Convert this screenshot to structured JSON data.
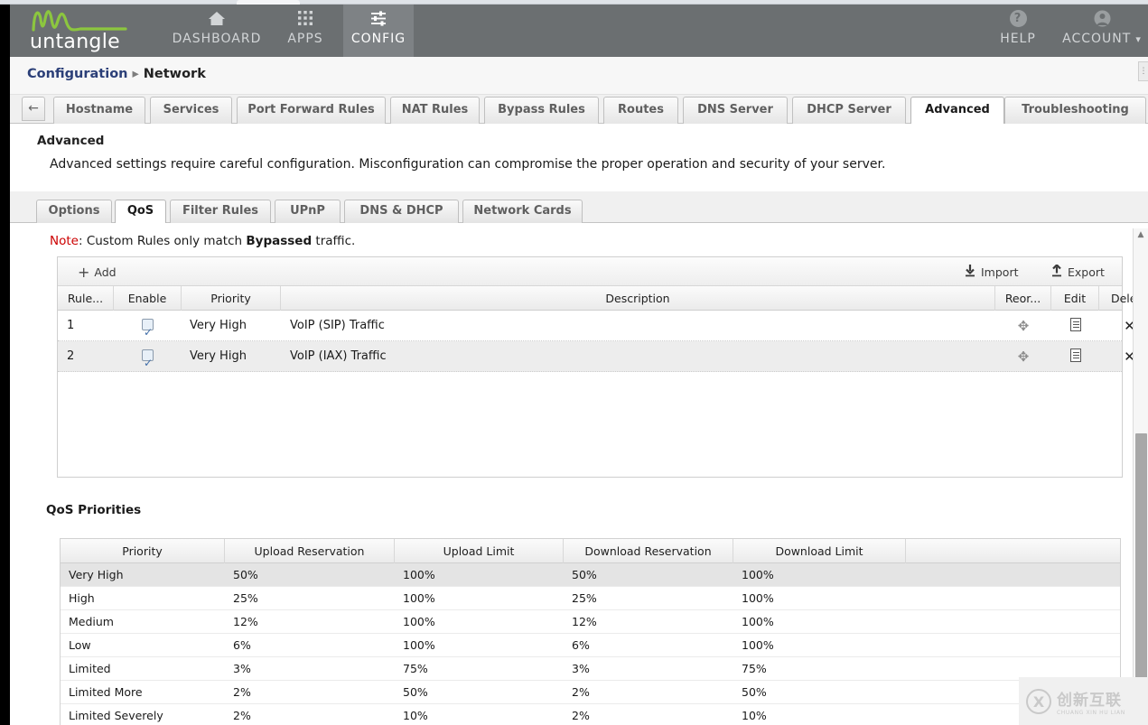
{
  "browser": {
    "tab_stub": ""
  },
  "header": {
    "logo_text": "untangle",
    "nav": [
      {
        "label": "DASHBOARD",
        "icon": "home-icon",
        "active": false
      },
      {
        "label": "APPS",
        "icon": "grid-icon",
        "active": false
      },
      {
        "label": "CONFIG",
        "icon": "sliders-icon",
        "active": true
      }
    ],
    "right_nav": [
      {
        "label": "HELP",
        "icon": "question-circle-icon"
      },
      {
        "label": "ACCOUNT",
        "icon": "user-circle-icon",
        "caret": "▾"
      }
    ]
  },
  "breadcrumb": {
    "root": "Configuration",
    "separator": "▸",
    "leaf": "Network",
    "corner_glyph": "⋮"
  },
  "primary_tabs": {
    "back_icon": "←",
    "items": [
      {
        "label": "Hostname",
        "active": false
      },
      {
        "label": "Services",
        "active": false
      },
      {
        "label": "Port Forward Rules",
        "active": false
      },
      {
        "label": "NAT Rules",
        "active": false
      },
      {
        "label": "Bypass Rules",
        "active": false
      },
      {
        "label": "Routes",
        "active": false
      },
      {
        "label": "DNS Server",
        "active": false
      },
      {
        "label": "DHCP Server",
        "active": false
      },
      {
        "label": "Advanced",
        "active": true
      },
      {
        "label": "Troubleshooting",
        "active": false
      }
    ]
  },
  "advanced": {
    "title": "Advanced",
    "description": "Advanced settings require careful configuration. Misconfiguration can compromise the proper operation and security of your server."
  },
  "sub_tabs": {
    "items": [
      {
        "label": "Options",
        "active": false
      },
      {
        "label": "QoS",
        "active": true
      },
      {
        "label": "Filter Rules",
        "active": false
      },
      {
        "label": "UPnP",
        "active": false
      },
      {
        "label": "DNS & DHCP",
        "active": false
      },
      {
        "label": "Network Cards",
        "active": false
      }
    ]
  },
  "note": {
    "label": "Note",
    "colon": ": ",
    "text_before": "Custom Rules only match ",
    "bold": "Bypassed",
    "text_after": " traffic."
  },
  "rules_grid": {
    "toolbar": {
      "add_label": "Add",
      "add_icon": "plus-icon",
      "import_label": "Import",
      "import_icon": "download-arrow-icon",
      "export_label": "Export",
      "export_icon": "upload-arrow-icon"
    },
    "columns": [
      "Rule...",
      "Enable",
      "Priority",
      "Description",
      "Reor...",
      "Edit",
      "Delete"
    ],
    "rows": [
      {
        "rule_id": "1",
        "enabled": true,
        "priority": "Very High",
        "description": "VoIP (SIP) Traffic",
        "reorder_icon": "move-icon",
        "edit_icon": "document-edit-icon",
        "delete_icon": "close-x-icon"
      },
      {
        "rule_id": "2",
        "enabled": true,
        "priority": "Very High",
        "description": "VoIP (IAX) Traffic",
        "reorder_icon": "move-icon",
        "edit_icon": "document-edit-icon",
        "delete_icon": "close-x-icon"
      }
    ]
  },
  "qos_priorities": {
    "title": "QoS Priorities",
    "columns": [
      "Priority",
      "Upload Reservation",
      "Upload Limit",
      "Download Reservation",
      "Download Limit",
      ""
    ],
    "rows": [
      {
        "priority": "Very High",
        "upload_reservation": "50%",
        "upload_limit": "100%",
        "download_reservation": "50%",
        "download_limit": "100%"
      },
      {
        "priority": "High",
        "upload_reservation": "25%",
        "upload_limit": "100%",
        "download_reservation": "25%",
        "download_limit": "100%"
      },
      {
        "priority": "Medium",
        "upload_reservation": "12%",
        "upload_limit": "100%",
        "download_reservation": "12%",
        "download_limit": "100%"
      },
      {
        "priority": "Low",
        "upload_reservation": "6%",
        "upload_limit": "100%",
        "download_reservation": "6%",
        "download_limit": "100%"
      },
      {
        "priority": "Limited",
        "upload_reservation": "3%",
        "upload_limit": "75%",
        "download_reservation": "3%",
        "download_limit": "75%"
      },
      {
        "priority": "Limited More",
        "upload_reservation": "2%",
        "upload_limit": "50%",
        "download_reservation": "2%",
        "download_limit": "50%"
      },
      {
        "priority": "Limited Severely",
        "upload_reservation": "2%",
        "upload_limit": "10%",
        "download_reservation": "2%",
        "download_limit": "10%"
      }
    ]
  },
  "scrollbar": {
    "up_arrow": "▲"
  },
  "watermark": {
    "mark": "X",
    "cn": "创新互联",
    "pinyin": "CHUANG XIN HU LIAN"
  },
  "colors": {
    "header_bg": "#6b6f71",
    "logo_green": "#8cc63f",
    "breadcrumb_link": "#2b3f78",
    "note_red": "#cc0000",
    "row_alt": "#ededed"
  }
}
